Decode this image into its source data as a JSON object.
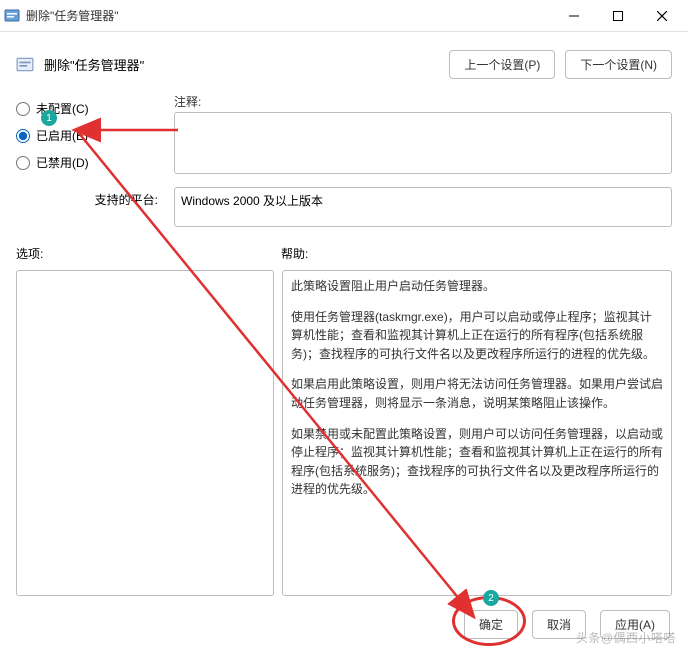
{
  "window": {
    "title": "删除\"任务管理器\""
  },
  "header": {
    "title": "删除\"任务管理器\"",
    "prev_button": "上一个设置(P)",
    "next_button": "下一个设置(N)"
  },
  "radios": {
    "not_configured": "未配置(C)",
    "enabled": "已启用(E)",
    "disabled": "已禁用(D)"
  },
  "comment": {
    "label": "注释:",
    "value": ""
  },
  "platform": {
    "label": "支持的平台:",
    "value": "Windows 2000 及以上版本"
  },
  "sections": {
    "options_label": "选项:",
    "help_label": "帮助:"
  },
  "help_text": {
    "p1": "此策略设置阻止用户启动任务管理器。",
    "p2": "使用任务管理器(taskmgr.exe)，用户可以启动或停止程序；监视其计算机性能；查看和监视其计算机上正在运行的所有程序(包括系统服务)；查找程序的可执行文件名以及更改程序所运行的进程的优先级。",
    "p3": "如果启用此策略设置，则用户将无法访问任务管理器。如果用户尝试启动任务管理器，则将显示一条消息，说明某策略阻止该操作。",
    "p4": "如果禁用或未配置此策略设置，则用户可以访问任务管理器，以启动或停止程序；监视其计算机性能；查看和监视其计算机上正在运行的所有程序(包括系统服务)；查找程序的可执行文件名以及更改程序所运行的进程的优先级。"
  },
  "footer": {
    "ok": "确定",
    "cancel": "取消",
    "apply": "应用(A)"
  },
  "annotations": {
    "badge1": "1",
    "badge2": "2"
  },
  "watermark": "头条@偶西小嗒嗒"
}
